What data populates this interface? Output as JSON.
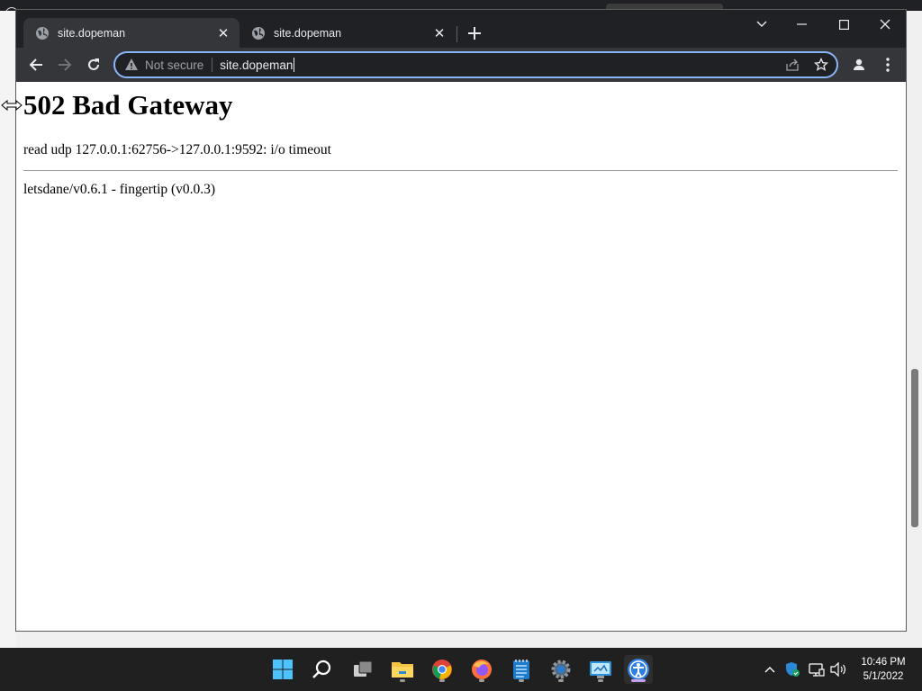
{
  "browser": {
    "tabs": [
      {
        "title": "site.dopeman",
        "active": true
      },
      {
        "title": "site.dopeman",
        "active": false
      }
    ],
    "omnibox": {
      "security_label": "Not secure",
      "url": "site.dopeman"
    }
  },
  "page": {
    "heading": "502 Bad Gateway",
    "message": "read udp 127.0.0.1:62756->127.0.0.1:9592: i/o timeout",
    "footer": "letsdane/v0.6.1 - fingertip (v0.0.3)"
  },
  "taskbar": {
    "apps": [
      "start-icon",
      "search-icon",
      "task-view-icon",
      "file-explorer-icon",
      "chrome-icon",
      "firefox-icon",
      "notepad-icon",
      "settings-icon",
      "control-panel-icon",
      "fingertip-icon"
    ],
    "active_app": "fingertip-icon",
    "clock": {
      "time": "10:46 PM",
      "date": "5/1/2022"
    }
  },
  "colors": {
    "titlebar": "#202124",
    "toolbar": "#35363a",
    "omnibox_focus": "#8ab4f8",
    "taskbar": "#202020"
  }
}
